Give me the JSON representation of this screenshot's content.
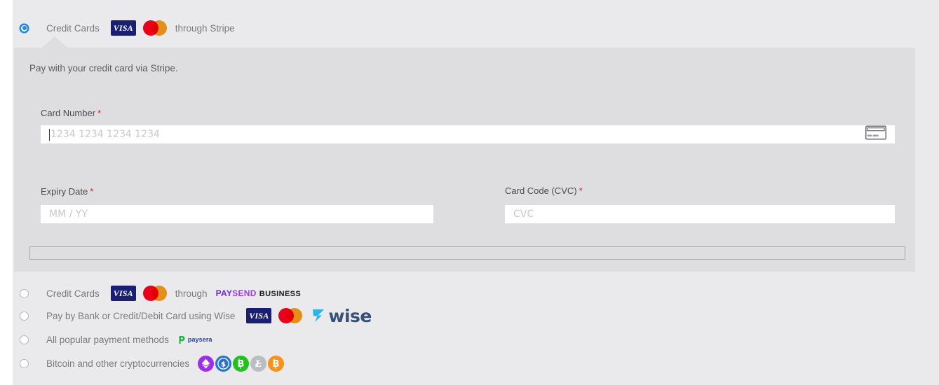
{
  "page": {
    "background_color": "#eae9ec",
    "panel_background_color": "#dedddf"
  },
  "payment_options": [
    {
      "id": "stripe",
      "selected": true,
      "label": "Credit Cards",
      "suffix": "through Stripe",
      "brands": [
        "visa",
        "mastercard"
      ],
      "provider_logo": "stripe-text"
    },
    {
      "id": "paysend",
      "selected": false,
      "label": "Credit Cards",
      "suffix": "through",
      "brands": [
        "visa",
        "mastercard"
      ],
      "provider_logo": "paysend-business",
      "paysend": {
        "pay": "PAY",
        "send": "SEND",
        "business": "BUSINESS"
      }
    },
    {
      "id": "wise",
      "selected": false,
      "label": "Pay by Bank or Credit/Debit Card using Wise",
      "suffix": "",
      "brands": [
        "visa",
        "mastercard"
      ],
      "provider_logo": "wise",
      "wise": {
        "wordmark": "wise"
      }
    },
    {
      "id": "paysera",
      "selected": false,
      "label": "All popular payment methods",
      "suffix": "",
      "brands": [],
      "provider_logo": "paysera",
      "paysera": {
        "wordmark": "paysera"
      }
    },
    {
      "id": "crypto",
      "selected": false,
      "label": "Bitcoin and other cryptocurrencies",
      "suffix": "",
      "brands": [],
      "provider_logo": "crypto-coins",
      "coins": [
        {
          "name": "ethereum",
          "symbol": "⧫",
          "color": "#9b30e8"
        },
        {
          "name": "usd-coin",
          "symbol": "$",
          "color": "#2775ca"
        },
        {
          "name": "bitcoin-cash",
          "symbol": "Ƀ",
          "color": "#22c11e"
        },
        {
          "name": "litecoin",
          "symbol": "Ł",
          "color": "#b9bec4"
        },
        {
          "name": "bitcoin",
          "symbol": "Ƀ",
          "color": "#f7931a"
        }
      ]
    }
  ],
  "stripe_panel": {
    "intro": "Pay with your credit card via Stripe.",
    "fields": {
      "card_number": {
        "label": "Card Number",
        "required_mark": "*",
        "value": "",
        "placeholder": "1234 1234 1234 1234",
        "icon": "credit-card-icon",
        "focused": true
      },
      "expiry": {
        "label": "Expiry Date",
        "required_mark": "*",
        "value": "",
        "placeholder": "MM / YY"
      },
      "cvc": {
        "label": "Card Code (CVC)",
        "required_mark": "*",
        "value": "",
        "placeholder": "CVC"
      }
    }
  },
  "brand_text": {
    "visa": "VISA"
  },
  "colors": {
    "radio_selected": "#1e88e5",
    "required_asterisk": "#e02020",
    "visa_blue": "#1a1f71",
    "mastercard_red": "#eb001b",
    "mastercard_yellow": "#f79e1b",
    "paysend_pay": "#6d28e0",
    "paysend_send": "#a03ae8",
    "wise_arrow": "#2cb4e8",
    "wise_navy": "#37517a",
    "paysera_blue": "#1f3fbf",
    "paysera_green": "#22b24c"
  }
}
